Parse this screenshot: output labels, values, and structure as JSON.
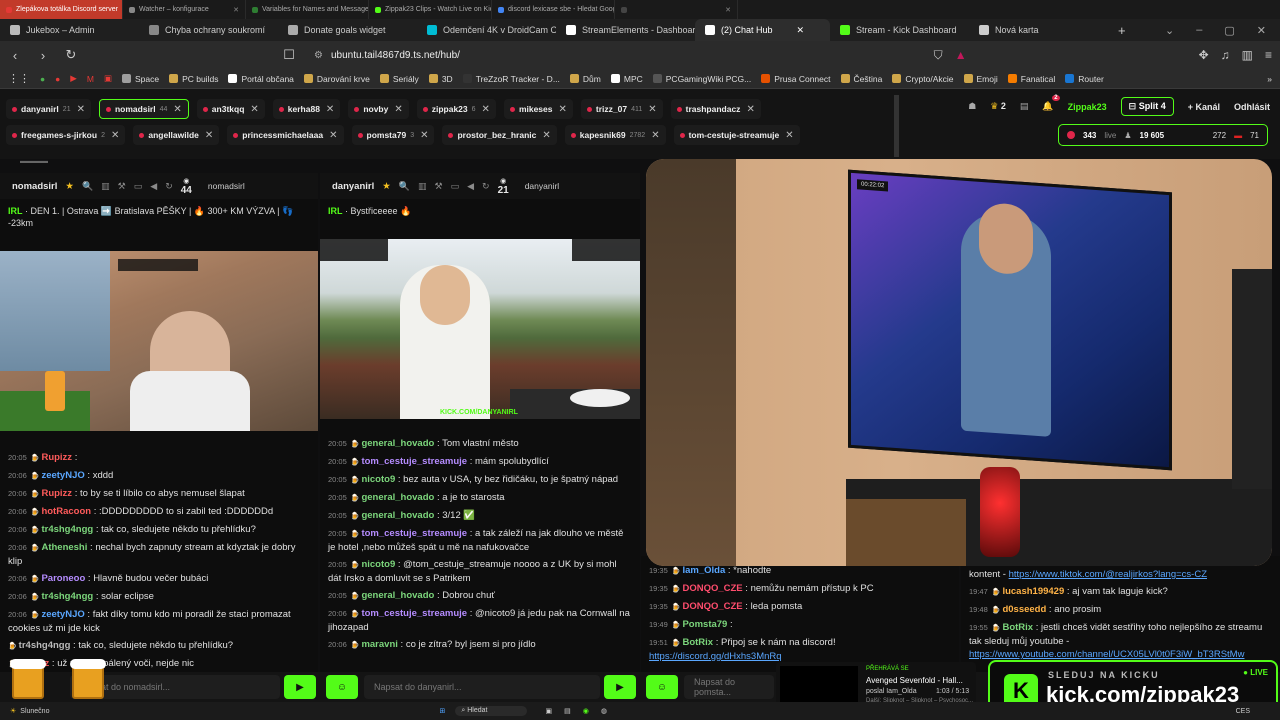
{
  "os_tabs": [
    {
      "label": "Zlepákova totálka Discord server",
      "color": "#e53935",
      "active": true
    },
    {
      "label": "Watcher – konfigurace",
      "color": "#888888"
    },
    {
      "label": "Variables for Names and Messages |",
      "color": "#2e7d32"
    },
    {
      "label": "Zippak23 Clips - Watch Live on Kick",
      "color": "#53fc18"
    },
    {
      "label": "discord lexicase sbe - Hledat Googlem",
      "color": "#4285f4"
    },
    {
      "label": "",
      "color": "#444444"
    }
  ],
  "browser_tabs": [
    {
      "label": "Jukebox – Admin",
      "color": "#bbbbbb"
    },
    {
      "label": "Chyba ochrany soukromí",
      "color": "#888888"
    },
    {
      "label": "Donate goals widget",
      "color": "#aaaaaa"
    },
    {
      "label": "Odemčení 4K v DroidCam OB",
      "color": "#00bcd4"
    },
    {
      "label": "StreamElements - Dashboard",
      "color": "#ffffff"
    },
    {
      "label": "(2) Chat Hub",
      "color": "#ffffff",
      "active": true
    },
    {
      "label": "Stream - Kick Dashboard",
      "color": "#53fc18"
    },
    {
      "label": "Nová karta",
      "color": "#cccccc"
    }
  ],
  "address": {
    "url": "ubuntu.tail4867d9.ts.net/hub/"
  },
  "bookmarks": [
    {
      "label": "Space",
      "color": "#9e9e9e"
    },
    {
      "label": "PC builds",
      "color": "#cfa64a"
    },
    {
      "label": "Portál občana",
      "color": "#ffffff"
    },
    {
      "label": "Darování krve",
      "color": "#cfa64a"
    },
    {
      "label": "Seriály",
      "color": "#cfa64a"
    },
    {
      "label": "3D",
      "color": "#cfa64a"
    },
    {
      "label": "TreZzoR Tracker - D...",
      "color": "#333333"
    },
    {
      "label": "Dům",
      "color": "#cfa64a"
    },
    {
      "label": "MPC",
      "color": "#ffffff"
    },
    {
      "label": "PCGamingWiki PCG...",
      "color": "#555555"
    },
    {
      "label": "Prusa Connect",
      "color": "#e65100"
    },
    {
      "label": "Čeština",
      "color": "#cfa64a"
    },
    {
      "label": "Crypto/Akcie",
      "color": "#cfa64a"
    },
    {
      "label": "Emoji",
      "color": "#cfa64a"
    },
    {
      "label": "Fanatical",
      "color": "#f57c00"
    },
    {
      "label": "Router",
      "color": "#1976d2"
    }
  ],
  "channel_row1": [
    {
      "name": "danyanirl",
      "count": "21"
    },
    {
      "name": "nomadsirl",
      "count": "44",
      "selected": true
    },
    {
      "name": "an3tkqq",
      "count": ""
    },
    {
      "name": "kerha88",
      "count": ""
    },
    {
      "name": "novby",
      "count": ""
    },
    {
      "name": "zippak23",
      "count": "6"
    },
    {
      "name": "mikeses",
      "count": ""
    },
    {
      "name": "trizz_07",
      "count": "411"
    },
    {
      "name": "trashpandacz",
      "count": ""
    }
  ],
  "channel_row2": [
    {
      "name": "freegames-s-jirkou",
      "count": "2"
    },
    {
      "name": "angellawilde",
      "count": ""
    },
    {
      "name": "princessmichaelaaa",
      "count": ""
    },
    {
      "name": "pomsta79",
      "count": "3"
    },
    {
      "name": "prostor_bez_hranic",
      "count": ""
    },
    {
      "name": "kapesnik69",
      "count": "2782"
    },
    {
      "name": "tom-cestuje-streamuje",
      "count": ""
    }
  ],
  "top_right": {
    "badge1": "2",
    "notif_count": "2",
    "user": "Zippak23",
    "split": "Split 4",
    "add_channel": "+ Kanál",
    "logout": "Odhlásit"
  },
  "live_stats": {
    "viewers": "343",
    "live_label": "live",
    "followers": "19 605",
    "s3": "272",
    "s4": "71"
  },
  "col1": {
    "channel": "nomadsirl",
    "viewers": "44",
    "input": "nomadsirl",
    "title_tag": "IRL",
    "title": "· DEN 1. | Ostrava ➡️ Bratislava PĚŠKY | 🔥 300+ KM VÝZVA | 👣 -23km",
    "messages": [
      {
        "t": "20:05",
        "u": "Rupizz",
        "c": "#ff5b5b",
        "m": ""
      },
      {
        "t": "20:06",
        "u": "zeetyNJO",
        "c": "#5aa7ff",
        "m": "xddd"
      },
      {
        "t": "20:06",
        "u": "Rupizz",
        "c": "#ff5b5b",
        "m": "to by se ti líbilo co abys nemusel šlapat"
      },
      {
        "t": "20:06",
        "u": "hotRacoon",
        "c": "#ff5b5b",
        "m": ":DDDDDDDDD to si zabil ted :DDDDDDd"
      },
      {
        "t": "20:06",
        "u": "tr4shg4ngg",
        "c": "#7cd67c",
        "m": "tak co, sledujete někdo tu přehlídku?"
      },
      {
        "t": "20:06",
        "u": "Atheneshi",
        "c": "#7cd67c",
        "m": "nechal bych zapnuty stream at kdyztak je dobry klip"
      },
      {
        "t": "20:06",
        "u": "Paroneoo",
        "c": "#b58cff",
        "m": "Hlavně budou večer bubáci"
      },
      {
        "t": "20:06",
        "u": "tr4shg4ngg",
        "c": "#7cd67c",
        "m": "solar eclipse"
      },
      {
        "t": "20:06",
        "u": "zeetyNJO",
        "c": "#5aa7ff",
        "m": "fakt díky tomu kdo mi poradil že staci promazat cookies už mi jde kick"
      },
      {
        "t": "",
        "u": "tr4shg4ngg",
        "c": "#bbbbbb",
        "m": "tak co, sledujete někdo tu přehlídku?"
      },
      {
        "t": "",
        "u": "Rupizz",
        "c": "#ff5b5b",
        "m": "už mám vypálený voči, nejde nic"
      }
    ],
    "placeholder": "Napsat do nomadsirl..."
  },
  "col2": {
    "channel": "danyanirl",
    "viewers": "21",
    "input": "danyanirl",
    "title_tag": "IRL",
    "title": "· Bystřiceeee 🔥",
    "watermark": "KICK.COM/DANYANIRL",
    "messages": [
      {
        "t": "20:05",
        "u": "general_hovado",
        "c": "#7cd67c",
        "m": "Tom vlastní město"
      },
      {
        "t": "20:05",
        "u": "tom_cestuje_streamuje",
        "c": "#b58cff",
        "m": "mám spolubydlící"
      },
      {
        "t": "20:05",
        "u": "nicoto9",
        "c": "#7cd67c",
        "m": "bez auta v USA, ty bez řidičáku, to je špatný nápad"
      },
      {
        "t": "20:05",
        "u": "general_hovado",
        "c": "#7cd67c",
        "m": "a je to starosta"
      },
      {
        "t": "20:05",
        "u": "general_hovado",
        "c": "#7cd67c",
        "m": "3/12 ✅"
      },
      {
        "t": "20:05",
        "u": "tom_cestuje_streamuje",
        "c": "#b58cff",
        "m": "a tak záleží na jak dlouho ve městě je hotel ,nebo můžeš spát u mě na nafukovačce"
      },
      {
        "t": "20:05",
        "u": "nicoto9",
        "c": "#7cd67c",
        "m": "@tom_cestuje_streamuje noooo a z UK by si mohl dát Irsko a domluvit se s Patrikem"
      },
      {
        "t": "20:05",
        "u": "general_hovado",
        "c": "#7cd67c",
        "m": "Dobrou chuť"
      },
      {
        "t": "20:06",
        "u": "tom_cestuje_streamuje",
        "c": "#b58cff",
        "m": "@nicoto9 já jedu pak na Cornwall na jihozapad"
      },
      {
        "t": "20:06",
        "u": "maravni",
        "c": "#7cd67c",
        "m": "co je zítra? byl jsem si pro jídlo"
      }
    ],
    "placeholder": "Napsat do danyanirl..."
  },
  "col3": {
    "screen_timer": "00:22:02",
    "messages": [
      {
        "t": "19:35",
        "u": "Iam_Olda",
        "c": "#5aa7ff",
        "m": "*nahodte"
      },
      {
        "t": "19:35",
        "u": "DONQO_CZE",
        "c": "#ff4d6d",
        "m": "nemůžu nemám přístup k PC"
      },
      {
        "t": "19:35",
        "u": "DONQO_CZE",
        "c": "#ff4d6d",
        "m": "leda pomsta"
      },
      {
        "t": "19:49",
        "u": "Pomsta79",
        "c": "#7cd67c",
        "m": ""
      },
      {
        "t": "19:51",
        "u": "BotRix",
        "c": "#7cd67c",
        "m": "Připoj se k nám na discord!",
        "link": "https://discord.gg/dHxhs3MnRq"
      }
    ],
    "placeholder": "Napsat do pomsta..."
  },
  "col4": {
    "messages": [
      {
        "t": "",
        "u": "",
        "c": "#ffffff",
        "m": "kontent -",
        "link": "https://www.tiktok.com/@realjirkos?lang=cs-CZ"
      },
      {
        "t": "19:47",
        "u": "lucash199429",
        "c": "#ffb347",
        "m": "aj vam tak laguje kick?"
      },
      {
        "t": "19:48",
        "u": "d0sseedd",
        "c": "#ffb347",
        "m": "ano prosim"
      },
      {
        "t": "19:55",
        "u": "BotRix",
        "c": "#7cd67c",
        "m": "jestli chceš vidět sestřihy toho nejlepšího ze streamu tak sleduj můj youtube -",
        "link": "https://www.youtube.com/channel/UCX05LVl0t0F3iW_bT3RStMw"
      }
    ]
  },
  "now_playing": {
    "label": "PŘEHRÁVÁ SE",
    "song": "Avenged Sevenfold - Hall...",
    "by": "poslal Iam_Olda",
    "time": "1:03 / 5:13",
    "next": "Další: Slipknot – Slipknot – Psychosoc..."
  },
  "kick_banner": {
    "small": "SLEDUJ NA KICKU",
    "big": "kick.com/zippak23",
    "live": "LIVE"
  },
  "taskbar": {
    "weather": "Slunečno",
    "search": "Hledat",
    "lang": "CES"
  },
  "colors": {
    "accent": "#53fc18",
    "live": "#e0264a"
  }
}
